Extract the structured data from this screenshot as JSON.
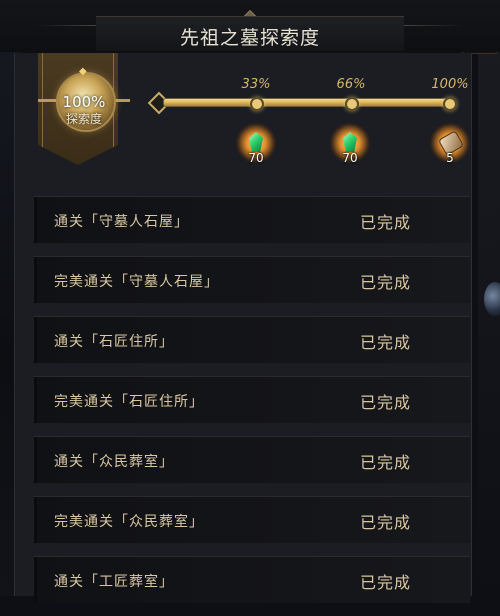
{
  "header": {
    "title": "先祖之墓探索度"
  },
  "summary": {
    "percent": "100%",
    "label": "探索度",
    "progress_fraction": 1.0
  },
  "milestones": [
    {
      "percent_label": "33%",
      "reward_icon": "green-gem-icon",
      "reward_count": "70"
    },
    {
      "percent_label": "66%",
      "reward_icon": "green-gem-icon",
      "reward_count": "70"
    },
    {
      "percent_label": "100%",
      "reward_icon": "scroll-icon",
      "reward_count": "5"
    }
  ],
  "tasks": [
    {
      "name": "通关「守墓人石屋」",
      "status": "已完成"
    },
    {
      "name": "完美通关「守墓人石屋」",
      "status": "已完成"
    },
    {
      "name": "通关「石匠住所」",
      "status": "已完成"
    },
    {
      "name": "完美通关「石匠住所」",
      "status": "已完成"
    },
    {
      "name": "通关「众民葬室」",
      "status": "已完成"
    },
    {
      "name": "完美通关「众民葬室」",
      "status": "已完成"
    },
    {
      "name": "通关「工匠葬室」",
      "status": "已完成"
    }
  ],
  "colors": {
    "accent_gold": "#d7b768",
    "text_light": "#e8e2d4",
    "panel": "#1b1d22"
  }
}
